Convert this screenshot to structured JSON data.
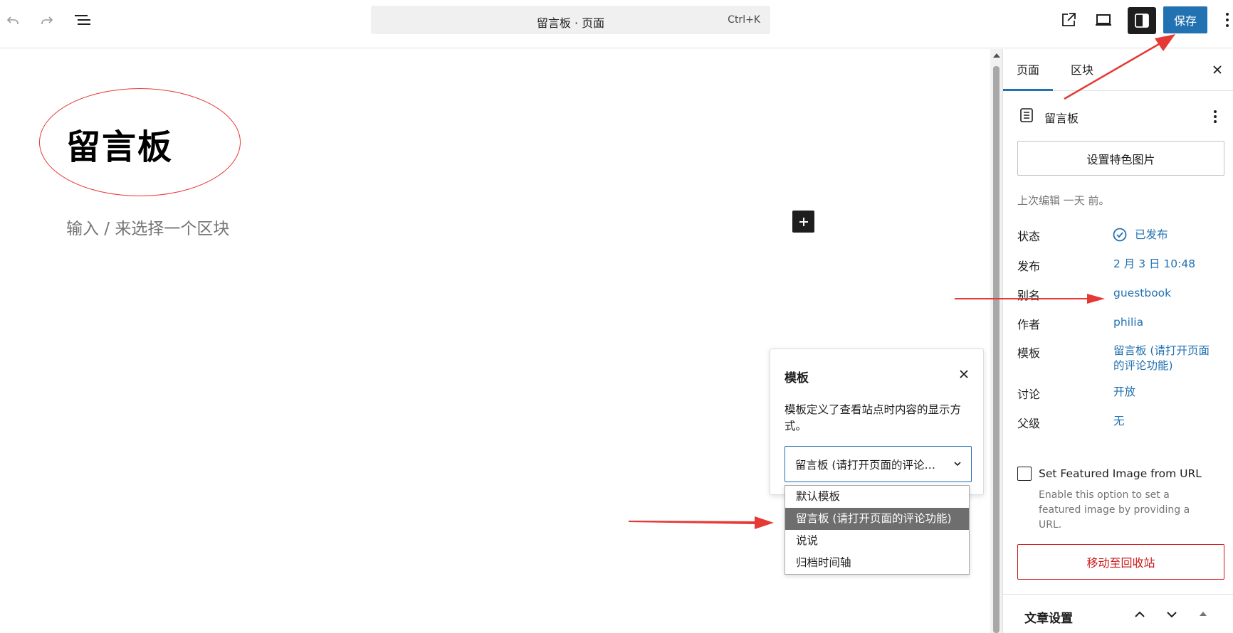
{
  "topbar": {
    "undo_icon": "undo-icon",
    "redo_icon": "redo-icon",
    "list_view_icon": "list-view-icon",
    "command_title": "留言板 · 页面",
    "command_shortcut": "Ctrl+K",
    "view_external_icon": "external-link-icon",
    "preview_icon": "desktop-preview-icon",
    "settings_icon": "sidebar-toggle-icon",
    "save_label": "保存",
    "options_icon": "more-vertical-icon"
  },
  "editor": {
    "title": "留言板",
    "block_placeholder": "输入 / 来选择一个区块"
  },
  "template_popover": {
    "title": "模板",
    "description": "模板定义了查看站点时内容的显示方式。",
    "selected_value": "留言板 (请打开页面的评论…",
    "options": [
      "默认模板",
      "留言板 (请打开页面的评论功能)",
      "说说",
      "归档时间轴"
    ],
    "selected_index": 1
  },
  "sidebar": {
    "tabs": [
      "页面",
      "区块"
    ],
    "active_tab": 0,
    "document_title": "留言板",
    "featured_image_button": "设置特色图片",
    "last_edited": "上次编辑 一天 前。",
    "properties": [
      {
        "label": "状态",
        "value": "已发布"
      },
      {
        "label": "发布",
        "value": "2 月 3 日 10:48"
      },
      {
        "label": "别名",
        "value": "guestbook"
      },
      {
        "label": "作者",
        "value": "philia"
      },
      {
        "label": "模板",
        "value": "留言板 (请打开页面",
        "value_line2": "的评论功能)"
      },
      {
        "label": "讨论",
        "value": "开放"
      },
      {
        "label": "父级",
        "value": "无"
      }
    ],
    "featured_url_label": "Set Featured Image from URL",
    "featured_url_checked": false,
    "featured_url_help": "Enable this option to set a featured image by providing a URL.",
    "trash_button": "移动至回收站",
    "article_settings": "文章设置"
  },
  "colors": {
    "accent": "#2271b1",
    "danger": "#cc1818",
    "annotation": "#e53935",
    "dark": "#1e1e1e"
  }
}
